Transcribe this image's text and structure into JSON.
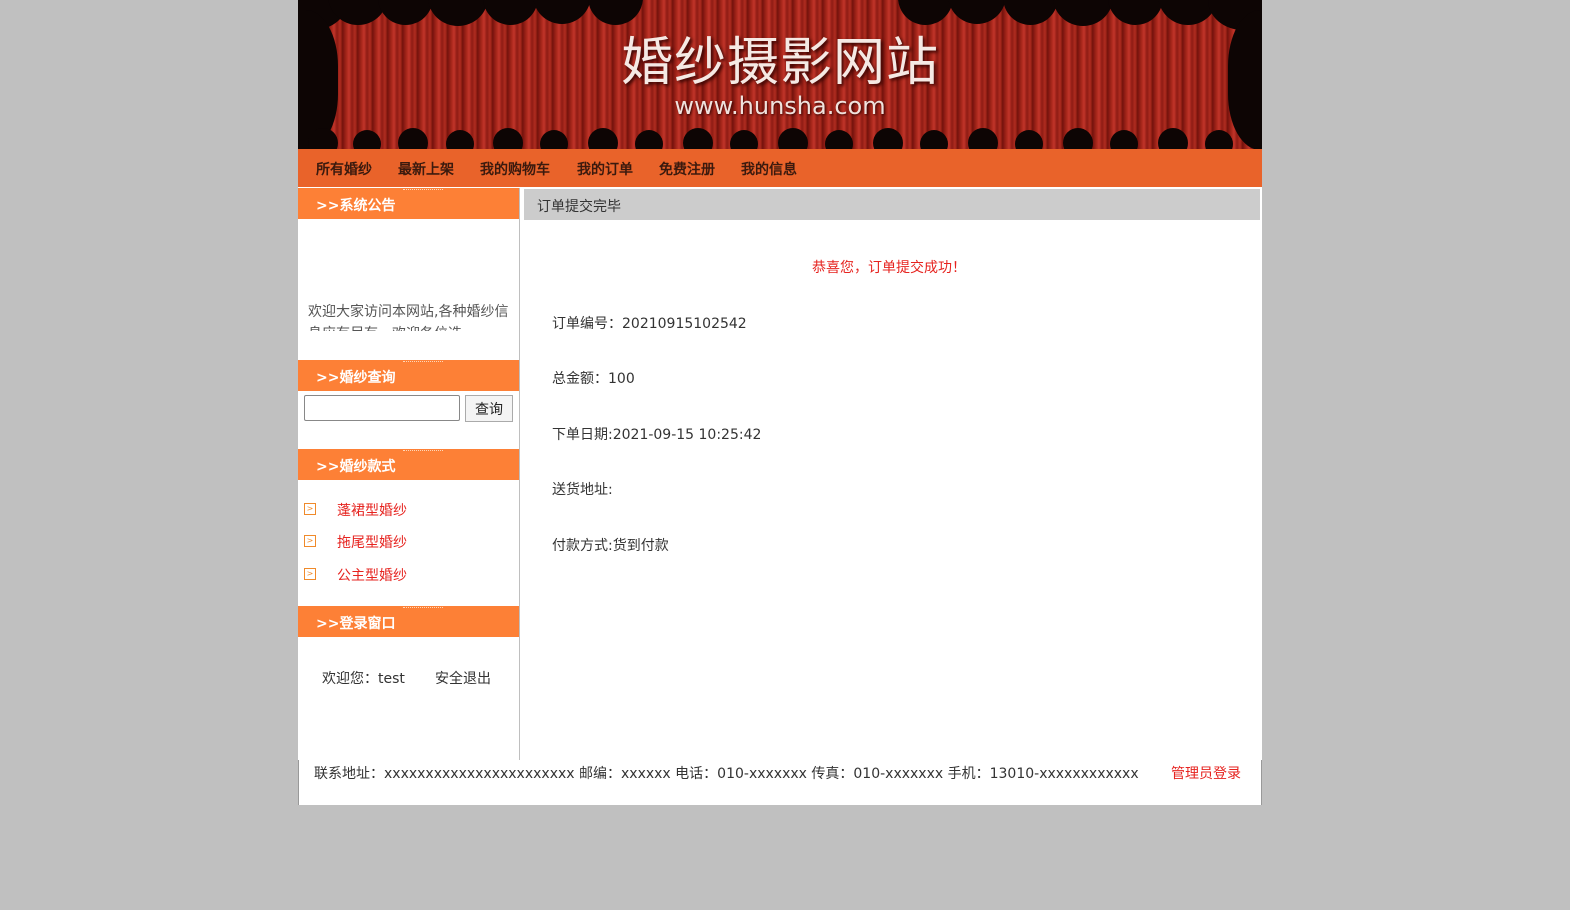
{
  "banner": {
    "title": "婚纱摄影网站",
    "url": "www.hunsha.com"
  },
  "nav": {
    "items": [
      "所有婚纱",
      "最新上架",
      "我的购物车",
      "我的订单",
      "免费注册",
      "我的信息"
    ]
  },
  "sidebar": {
    "notice": {
      "title": ">>系统公告",
      "text": "欢迎大家访问本网站,各种婚纱信息应有尽有，欢迎各位选"
    },
    "search": {
      "title": ">>婚纱查询",
      "input_value": "",
      "button": "查询"
    },
    "styles": {
      "title": ">>婚纱款式",
      "items": [
        "蓬裙型婚纱",
        "拖尾型婚纱",
        "公主型婚纱"
      ]
    },
    "login": {
      "title": ">>登录窗口",
      "welcome": "欢迎您：test",
      "logout": "安全退出"
    }
  },
  "main": {
    "header": "订单提交完毕",
    "success": "恭喜您，订单提交成功！",
    "order_no": "订单编号：20210915102542",
    "total": "总金额：100",
    "order_date": "下单日期:2021-09-15 10:25:42",
    "address": "送货地址:",
    "payment": "付款方式:货到付款"
  },
  "footer": {
    "contact": "联系地址：xxxxxxxxxxxxxxxxxxxxxxx   邮编：xxxxxx 电话：010-xxxxxxx   传真：010-xxxxxxx   手机：13010-xxxxxxxxxxxx",
    "admin": "管理员登录"
  },
  "colors": {
    "nav_bg": "#e9632a",
    "side_head_bg": "#fd8036",
    "accent_red": "#e6231f",
    "page_bg": "#c0c0c0"
  }
}
